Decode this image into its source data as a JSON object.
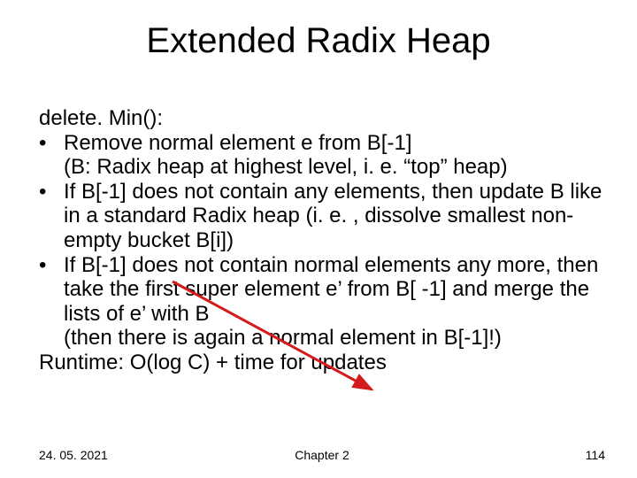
{
  "title": "Extended Radix Heap",
  "lines": {
    "l0": "delete. Min():",
    "b1": "Remove normal element e from B[-1]\n(B: Radix heap at highest level, i. e. “top” heap)",
    "b2": "If B[-1] does not contain any elements, then update B like in a standard Radix heap (i. e. , dissolve smallest non-empty bucket B[i])",
    "b3": "If B[-1] does not contain normal elements any more, then take the first super element e’ from B[ -1] and merge the lists of e’ with B\n(then there is again a normal element in B[-1]!)",
    "l4": "Runtime: O(log C) + time for updates"
  },
  "bullet": "•",
  "footer": {
    "date": "24. 05. 2021",
    "chapter": "Chapter 2",
    "page": "114"
  },
  "colors": {
    "arrow": "#d41a1a"
  }
}
